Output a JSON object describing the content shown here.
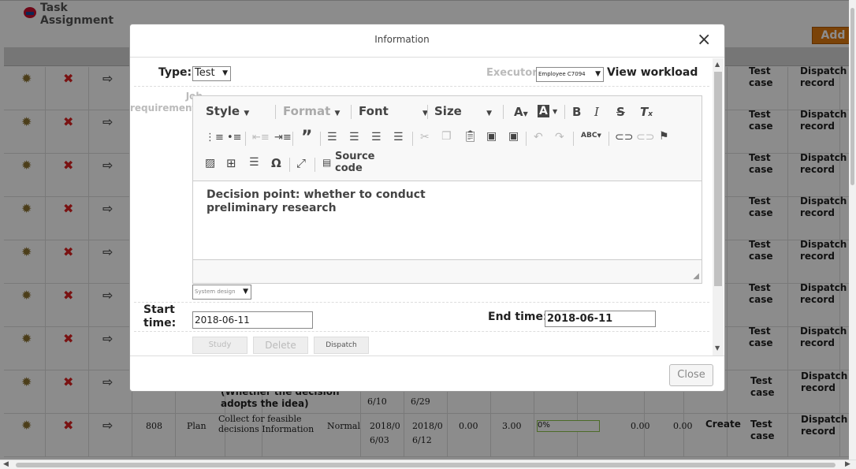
{
  "background": {
    "app_title": "Task Assignment",
    "add_label": "Add",
    "rows": [
      {
        "col_test": "Test case",
        "col_dispatch": "Dispatch record"
      },
      {
        "col_test": "Test case",
        "col_dispatch": "Dispatch record"
      },
      {
        "col_test": "Test case",
        "col_dispatch": "Dispatch record"
      },
      {
        "col_test": "Test case",
        "col_dispatch": "Dispatch record"
      },
      {
        "col_test": "Test case",
        "col_dispatch": "Dispatch record"
      },
      {
        "col_test": "Test case",
        "col_dispatch": "Dispatch record"
      },
      {
        "col_test": "Test case",
        "col_dispatch": "Dispatch record"
      }
    ],
    "row8": {
      "decision_text": "(Whether the decision adopts the idea)",
      "start_tail": "6/10",
      "end_tail": "6/29",
      "test_case": "Test case",
      "dispatch": "Dispatch record"
    },
    "row9": {
      "id": "808",
      "type": "Plan",
      "desc": "Collect for feasible decisions Information",
      "priority": "Normal",
      "start_a": "2018/0",
      "start_b": "6/03",
      "end_a": "2018/0",
      "end_b": "6/12",
      "v1": "0.00",
      "v2": "3.00",
      "progress": "0%",
      "v3": "0.00",
      "v4": "0.00",
      "create": "Create",
      "test_case": "Test case",
      "dispatch": "Dispatch record"
    }
  },
  "dialog": {
    "title": "Information",
    "type_label": "Type:",
    "type_value": "Test",
    "executor_label": "Executor:",
    "executor_value": "Employee C7094",
    "view_workload": "View workload",
    "job_req_label": "Job requirements:",
    "toolbar": {
      "style": "Style",
      "format": "Format",
      "font": "Font",
      "size": "Size",
      "source_code": "Source code"
    },
    "editor_text": "Decision point: whether to conduct preliminary research",
    "category_value": "System design",
    "start_label": "Start time:",
    "start_value": "2018-06-11",
    "end_label": "End time:",
    "end_value": "2018-06-11",
    "btn_study": "Study",
    "btn_delete": "Delete",
    "btn_dispatch": "Dispatch",
    "close_label": "Close"
  }
}
